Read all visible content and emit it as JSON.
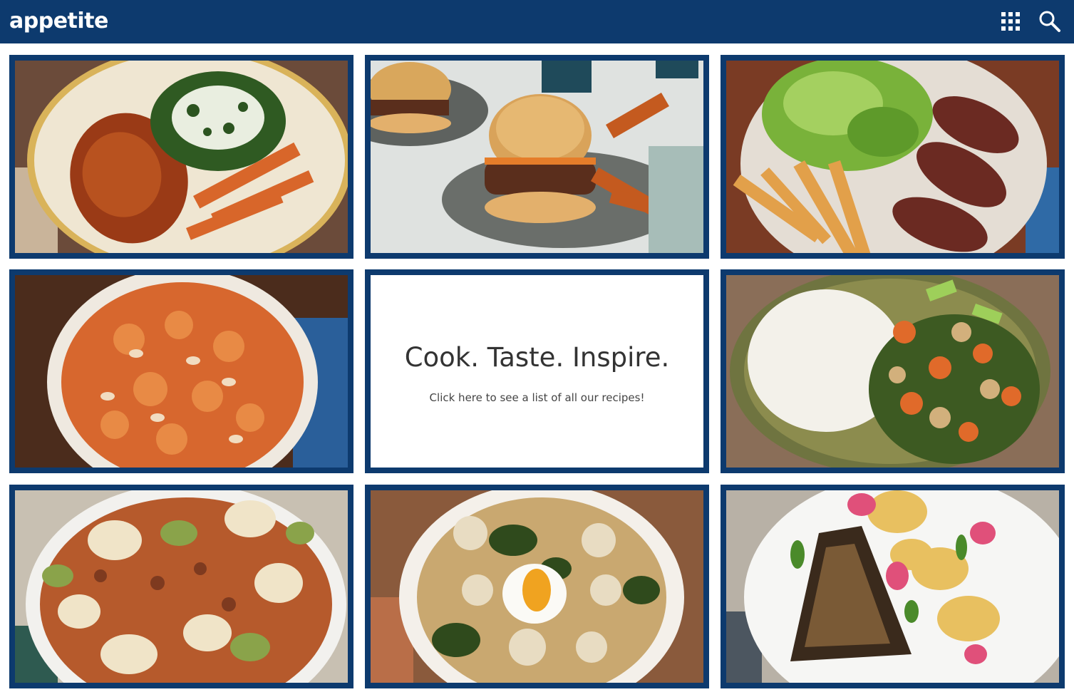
{
  "app": {
    "logo_text": "appetite"
  },
  "header": {
    "grid_icon": "apps-grid-icon",
    "search_icon": "search-icon"
  },
  "hero": {
    "title": "Cook. Taste. Inspire.",
    "subtitle": "Click here to see a list of all our recipes!"
  },
  "colors": {
    "brand": "#0d3a6e",
    "background": "#ffffff",
    "text": "#333333"
  },
  "tiles": [
    {
      "kind": "image",
      "dish": "glazed-chicken-kale-rice-carrots"
    },
    {
      "kind": "image",
      "dish": "burger-sweet-potato-wedges"
    },
    {
      "kind": "image",
      "dish": "steak-salad-fries"
    },
    {
      "kind": "image",
      "dish": "shell-pasta-almonds"
    },
    {
      "kind": "promo"
    },
    {
      "kind": "image",
      "dish": "chicken-stir-fry-rice"
    },
    {
      "kind": "image",
      "dish": "rice-cakes-pork-bok-choy"
    },
    {
      "kind": "image",
      "dish": "cauliflower-kale-soft-egg"
    },
    {
      "kind": "image",
      "dish": "seared-fish-potatoes-radish"
    }
  ]
}
